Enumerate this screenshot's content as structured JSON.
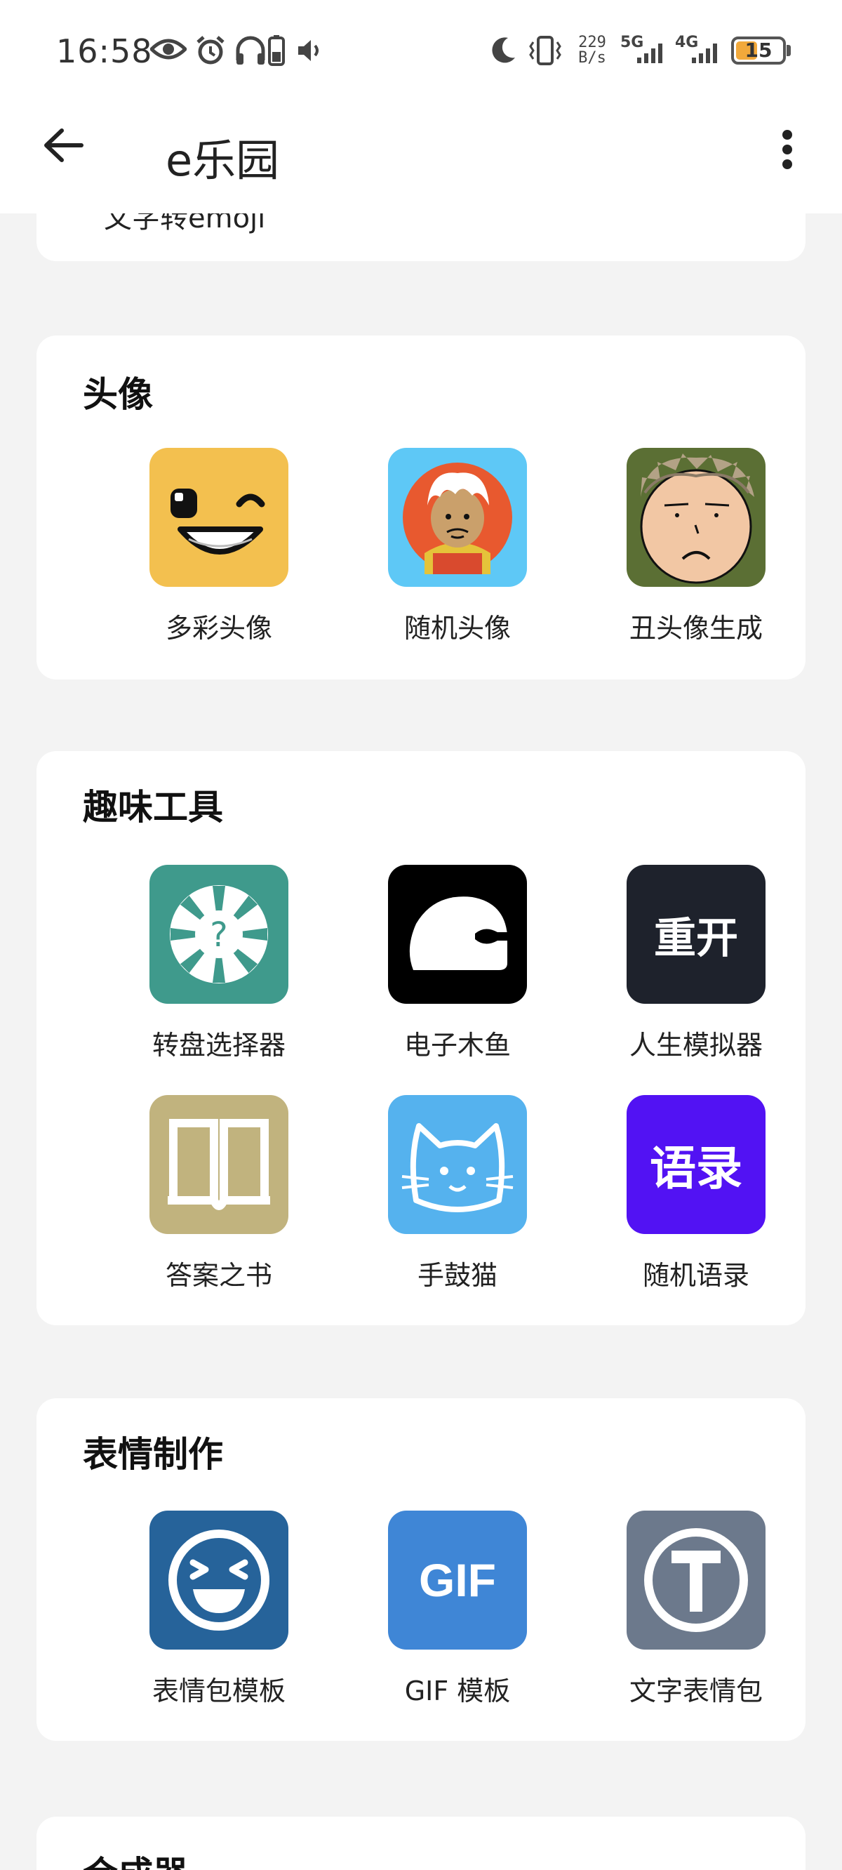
{
  "status_bar": {
    "time": "16:58",
    "net_speed_top": "229",
    "net_speed_bottom": "B/s",
    "net_5g": "5G",
    "net_4g": "4G",
    "battery": "15",
    "icons": [
      "eye-icon",
      "alarm-icon",
      "headphones-icon",
      "phone-battery-icon",
      "volume-icon",
      "moon-icon",
      "vibrate-icon",
      "signal-icon"
    ]
  },
  "app_bar": {
    "title": "e乐园",
    "back_icon": "arrow-left-icon",
    "more_icon": "more-vert-icon"
  },
  "partial_card": {
    "text": "文字转emoji"
  },
  "sections": [
    {
      "title": "头像",
      "items": [
        {
          "label": "多彩头像",
          "icon": "wink-face-icon",
          "color": "#f3c04f"
        },
        {
          "label": "随机头像",
          "icon": "avatar-face-icon",
          "color": "#5ec8f6"
        },
        {
          "label": "丑头像生成",
          "icon": "ugly-face-icon",
          "color": "#5b6f34"
        }
      ]
    },
    {
      "title": "趣味工具",
      "items": [
        {
          "label": "转盘选择器",
          "icon": "wheel-question-icon",
          "color": "#3f9a8c"
        },
        {
          "label": "电子木鱼",
          "icon": "wooden-fish-icon",
          "color": "#000000"
        },
        {
          "label": "人生模拟器",
          "icon_text": "重开",
          "icon": "restart-text-icon",
          "color": "#1e222c"
        },
        {
          "label": "答案之书",
          "icon": "book-icon",
          "color": "#c1b37e"
        },
        {
          "label": "手鼓猫",
          "icon": "cat-icon",
          "color": "#55b2ee"
        },
        {
          "label": "随机语录",
          "icon_text": "语录",
          "icon": "quotes-text-icon",
          "color": "#5212f3"
        }
      ]
    },
    {
      "title": "表情制作",
      "items": [
        {
          "label": "表情包模板",
          "icon": "laugh-face-icon",
          "color": "#26639a"
        },
        {
          "label": "GIF 模板",
          "icon_text": "GIF",
          "icon": "gif-text-icon",
          "color": "#3f86d6"
        },
        {
          "label": "文字表情包",
          "icon": "text-t-icon",
          "color": "#6c798c"
        }
      ]
    },
    {
      "title": "合成器"
    }
  ]
}
